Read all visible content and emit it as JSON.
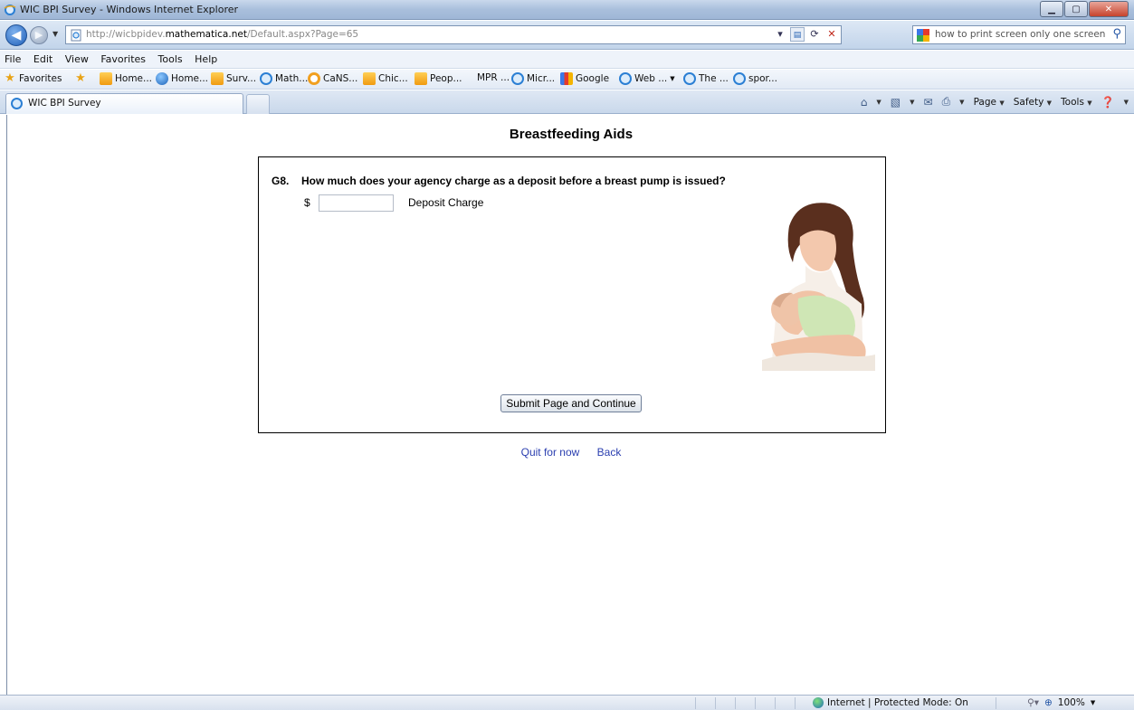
{
  "window": {
    "title": "WIC BPI Survey - Windows Internet Explorer"
  },
  "address_bar": {
    "url_prefix": "http://wicbpidev.",
    "url_domain": "mathematica.net",
    "url_suffix": "/Default.aspx?Page=65"
  },
  "search": {
    "query": "how to print screen only one screen"
  },
  "menu": [
    "File",
    "Edit",
    "View",
    "Favorites",
    "Tools",
    "Help"
  ],
  "favorites_bar": {
    "label": "Favorites",
    "items": [
      "Home...",
      "Home...",
      "Surv...",
      "Math...",
      "CaNS...",
      "Chic...",
      "Peop...",
      "MPR ...",
      "Micr...",
      "Google",
      "Web ...",
      "The ...",
      "spor..."
    ]
  },
  "tab": {
    "label": "WIC BPI Survey"
  },
  "command_bar": {
    "page": "Page",
    "safety": "Safety",
    "tools": "Tools"
  },
  "page": {
    "title": "Breastfeeding Aids",
    "question_number": "G8.",
    "question_text": "How much does your agency charge as a deposit before a breast pump is issued?",
    "currency_symbol": "$",
    "deposit_value": "",
    "deposit_label": "Deposit Charge",
    "submit_label": "Submit Page and Continue",
    "quit_link": "Quit for now",
    "back_link": "Back"
  },
  "status_bar": {
    "zone": "Internet | Protected Mode: On",
    "zoom": "100%"
  }
}
